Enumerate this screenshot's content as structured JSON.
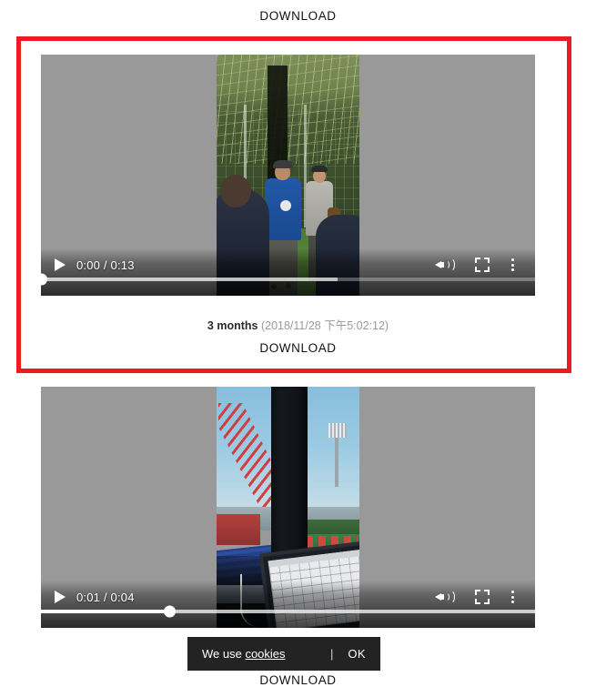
{
  "page": {
    "background": "#ffffff",
    "highlight_color": "#ed1c24"
  },
  "download_links": {
    "top": "DOWNLOAD",
    "middle": "DOWNLOAD",
    "bottom": "DOWNLOAD"
  },
  "videos": [
    {
      "id": "video-1",
      "highlighted": true,
      "current_time": "0:00",
      "duration": "0:13",
      "time_display": "0:00 / 0:13",
      "played_percent": 0,
      "loaded_percent": 60,
      "letterbox_color": "#999999",
      "controls": {
        "play_label": "play-button",
        "volume_label": "volume",
        "fullscreen_label": "fullscreen",
        "more_label": "more options"
      },
      "caption": {
        "age": "3 months",
        "date": "(2018/11/28 下午5:02:12)"
      }
    },
    {
      "id": "video-2",
      "highlighted": false,
      "current_time": "0:01",
      "duration": "0:04",
      "time_display": "0:01 / 0:04",
      "played_percent": 26,
      "loaded_percent": 100,
      "letterbox_color": "#999999",
      "controls": {
        "play_label": "play-button",
        "volume_label": "volume",
        "fullscreen_label": "fullscreen",
        "more_label": "more options"
      }
    }
  ],
  "cookie_banner": {
    "text_prefix": "We use ",
    "link_text": "cookies",
    "separator": "|",
    "accept_label": "OK",
    "background": "#232323"
  }
}
